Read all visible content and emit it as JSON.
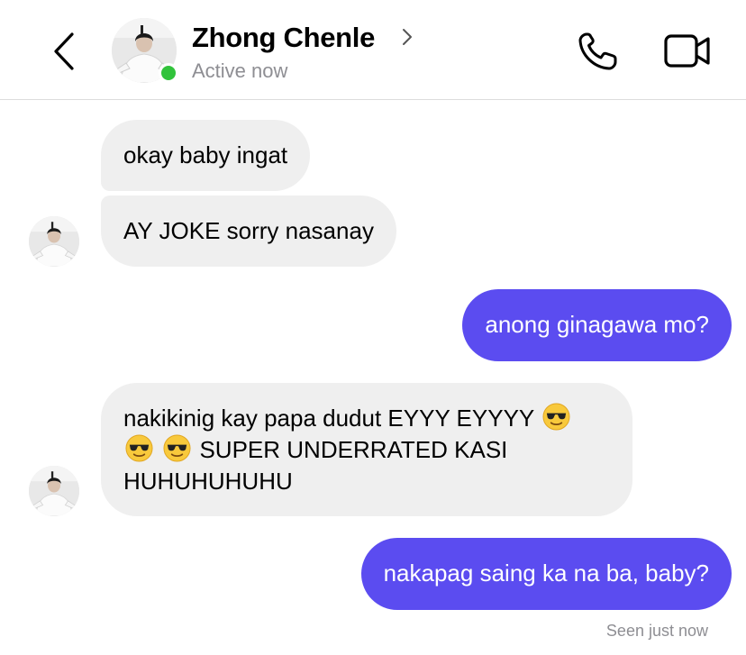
{
  "header": {
    "contact_name": "Zhong Chenle",
    "status": "Active now",
    "icons": {
      "back": "chevron-left-icon",
      "profile_link": "chevron-right-icon",
      "call": "phone-icon",
      "video": "video-camera-icon"
    },
    "presence_color": "#31c33b"
  },
  "messages": [
    {
      "sender": "contact",
      "text": "okay baby ingat"
    },
    {
      "sender": "contact",
      "text": "AY JOKE sorry nasanay"
    },
    {
      "sender": "me",
      "text": "anong ginagawa mo?"
    },
    {
      "sender": "contact",
      "text_part1": "nakikinig kay papa dudut EYYY EYYYY",
      "text_part2": "SUPER UNDERRATED KASI HUHUHUHUHU",
      "emoji": "sunglasses-face-emoji"
    },
    {
      "sender": "me",
      "text": "nakapag saing ka na ba, baby?"
    }
  ],
  "read_receipt": "Seen just now",
  "colors": {
    "outgoing_bubble": "#5b4cf0",
    "incoming_bubble": "#efefef",
    "secondary_text": "#8e8e93"
  }
}
